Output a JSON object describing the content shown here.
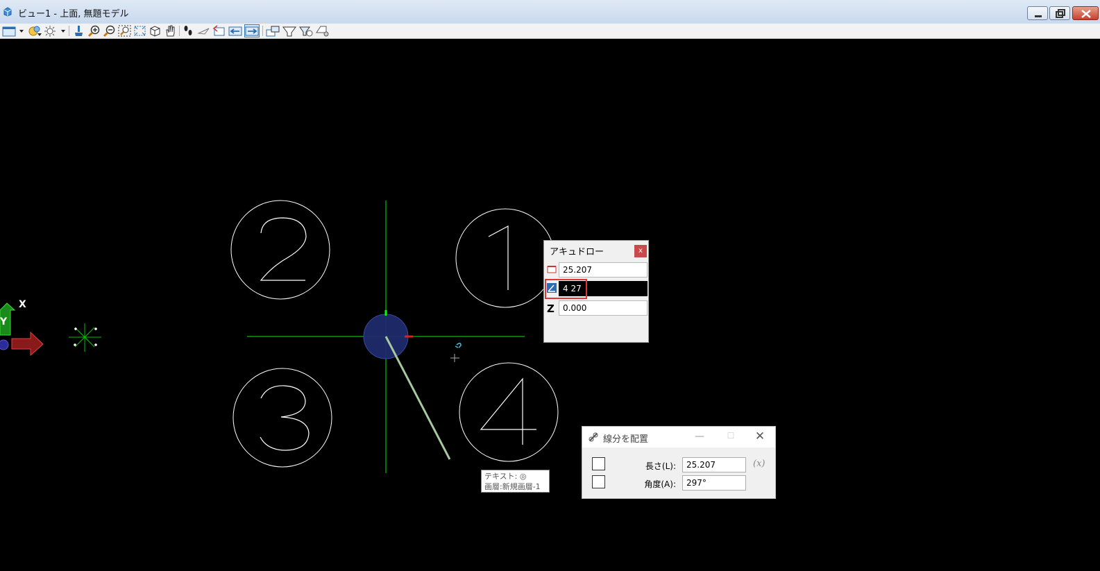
{
  "window": {
    "title": "ビュー1 - 上面, 無題モデル"
  },
  "toolbar": {
    "icons": [
      "view-attributes-icon",
      "display-style-icon",
      "lighting-icon",
      "update-view-icon",
      "zoom-in-icon",
      "zoom-out-icon",
      "window-area-icon",
      "fit-view-icon",
      "rotate-view-icon",
      "pan-view-icon",
      "walk-icon",
      "fly-icon",
      "view-previous-icon",
      "view-next-icon",
      "copy-view-icon",
      "clip-volume-icon",
      "clip-mask-icon",
      "view-toggle-icon",
      "camera-icon"
    ]
  },
  "canvas": {
    "circle_labels": [
      "2",
      "1",
      "3",
      "4"
    ],
    "axis_labels": {
      "y": "Y",
      "x": "X"
    }
  },
  "accudraw": {
    "title": "アキュドロー",
    "close_label": "x",
    "distance_value": "25.207",
    "angle_value": "4 27",
    "z_label": "Z",
    "z_value": "0.000"
  },
  "place_line": {
    "title": "線分を配置",
    "min_label": "—",
    "max_label": "☐",
    "close_label": "✕",
    "length_label": "長さ(L):",
    "length_value": "25.207",
    "angle_label": "角度(A):",
    "angle_value": "297°",
    "fx_label": "(x)"
  },
  "tooltip": {
    "line1": "テキスト: ◎",
    "line2": "画層:新規画層-1"
  },
  "colors": {
    "canvas_bg": "#000000",
    "circle_stroke": "#ffffff",
    "compass_green": "#00c000",
    "compass_fill": "#1f2a6b",
    "line_preview": "#a6c9a0",
    "highlight_red": "#e0343b"
  }
}
